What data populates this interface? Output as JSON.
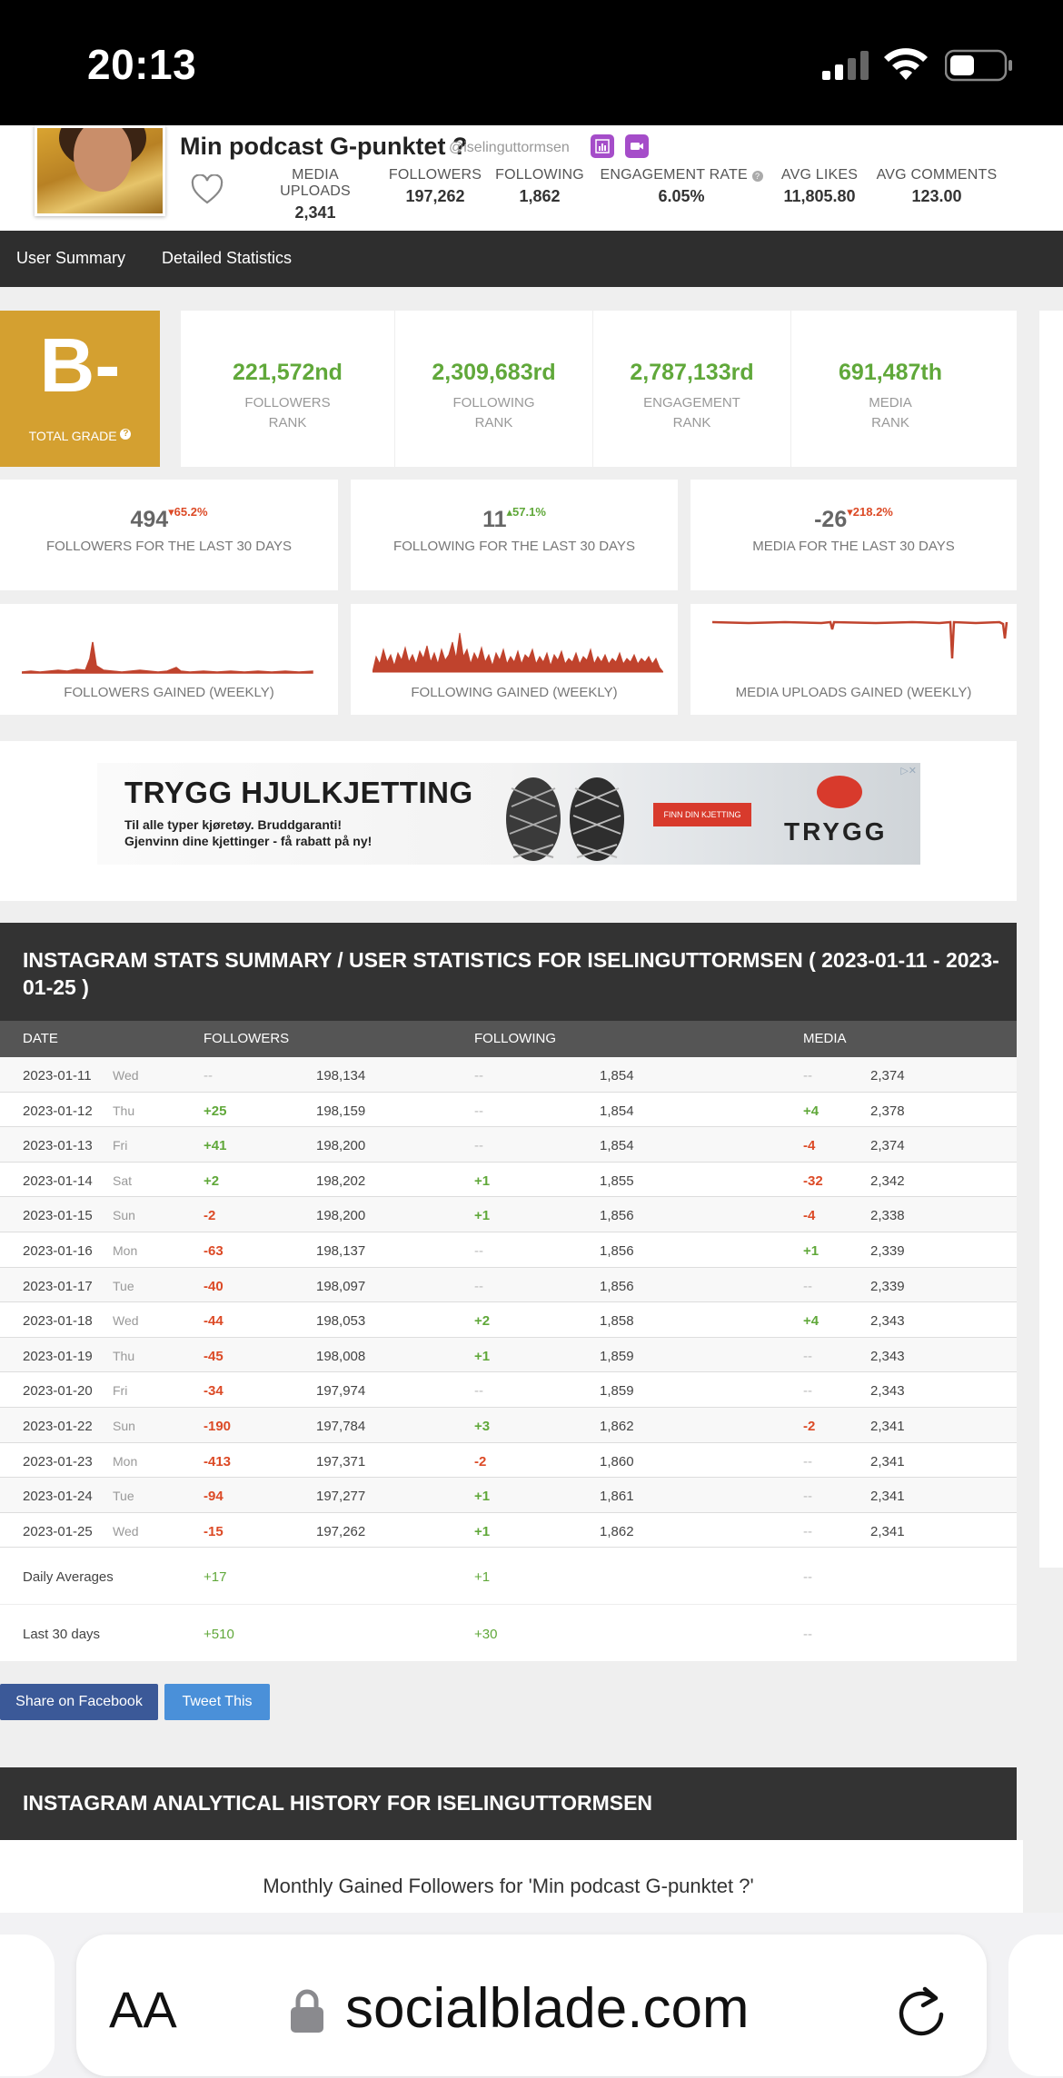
{
  "status_bar": {
    "time": "20:13"
  },
  "profile": {
    "name": "Min podcast G-punktet ?",
    "handle": "@iselinguttormsen",
    "stats": [
      {
        "label": "MEDIA UPLOADS",
        "value": "2,341"
      },
      {
        "label": "FOLLOWERS",
        "value": "197,262"
      },
      {
        "label": "FOLLOWING",
        "value": "1,862"
      },
      {
        "label": "ENGAGEMENT RATE",
        "value": "6.05%"
      },
      {
        "label": "AVG LIKES",
        "value": "11,805.80"
      },
      {
        "label": "AVG COMMENTS",
        "value": "123.00"
      }
    ]
  },
  "nav": {
    "items": [
      "User Summary",
      "Detailed Statistics"
    ]
  },
  "grade": {
    "letter": "B-",
    "label": "TOTAL GRADE",
    "help": "?"
  },
  "ranks": [
    {
      "value": "221,572nd",
      "label1": "FOLLOWERS",
      "label2": "RANK"
    },
    {
      "value": "2,309,683rd",
      "label1": "FOLLOWING",
      "label2": "RANK"
    },
    {
      "value": "2,787,133rd",
      "label1": "ENGAGEMENT",
      "label2": "RANK"
    },
    {
      "value": "691,487th",
      "label1": "MEDIA",
      "label2": "RANK"
    }
  ],
  "last30": [
    {
      "value": "494",
      "change": "▾65.2%",
      "label": "FOLLOWERS FOR THE LAST 30 DAYS"
    },
    {
      "value": "11",
      "change": "▴57.1%",
      "label": "FOLLOWING FOR THE LAST 30 DAYS"
    },
    {
      "value": "-26",
      "change": "▾218.2%",
      "label": "MEDIA FOR THE LAST 30 DAYS"
    }
  ],
  "sparklines": [
    {
      "label": "FOLLOWERS GAINED (WEEKLY)"
    },
    {
      "label": "FOLLOWING GAINED (WEEKLY)"
    },
    {
      "label": "MEDIA UPLOADS GAINED (WEEKLY)"
    }
  ],
  "ad": {
    "headline": "TRYGG HJULKJETTING",
    "line1": "Til alle typer kjøretøy. Bruddgaranti!",
    "line2": "Gjenvinn dine kjettinger - få rabatt på ny!",
    "cta": "FINN DIN KJETTING",
    "brand": "TRYGG",
    "close": "▷✕"
  },
  "summary": {
    "title": "INSTAGRAM STATS SUMMARY / USER STATISTICS FOR ISELINGUTTORMSEN ( 2023-01-11 - 2023-01-25 )",
    "columns": [
      "DATE",
      "FOLLOWERS",
      "FOLLOWING",
      "MEDIA"
    ],
    "rows": [
      {
        "date": "2023-01-11",
        "day": "Wed",
        "fch": "--",
        "fval": "198,134",
        "gch": "--",
        "gval": "1,854",
        "mch": "--",
        "mval": "2,374"
      },
      {
        "date": "2023-01-12",
        "day": "Thu",
        "fch": "+25",
        "fval": "198,159",
        "gch": "--",
        "gval": "1,854",
        "mch": "+4",
        "mval": "2,378"
      },
      {
        "date": "2023-01-13",
        "day": "Fri",
        "fch": "+41",
        "fval": "198,200",
        "gch": "--",
        "gval": "1,854",
        "mch": "-4",
        "mval": "2,374"
      },
      {
        "date": "2023-01-14",
        "day": "Sat",
        "fch": "+2",
        "fval": "198,202",
        "gch": "+1",
        "gval": "1,855",
        "mch": "-32",
        "mval": "2,342"
      },
      {
        "date": "2023-01-15",
        "day": "Sun",
        "fch": "-2",
        "fval": "198,200",
        "gch": "+1",
        "gval": "1,856",
        "mch": "-4",
        "mval": "2,338"
      },
      {
        "date": "2023-01-16",
        "day": "Mon",
        "fch": "-63",
        "fval": "198,137",
        "gch": "--",
        "gval": "1,856",
        "mch": "+1",
        "mval": "2,339"
      },
      {
        "date": "2023-01-17",
        "day": "Tue",
        "fch": "-40",
        "fval": "198,097",
        "gch": "--",
        "gval": "1,856",
        "mch": "--",
        "mval": "2,339"
      },
      {
        "date": "2023-01-18",
        "day": "Wed",
        "fch": "-44",
        "fval": "198,053",
        "gch": "+2",
        "gval": "1,858",
        "mch": "+4",
        "mval": "2,343"
      },
      {
        "date": "2023-01-19",
        "day": "Thu",
        "fch": "-45",
        "fval": "198,008",
        "gch": "+1",
        "gval": "1,859",
        "mch": "--",
        "mval": "2,343"
      },
      {
        "date": "2023-01-20",
        "day": "Fri",
        "fch": "-34",
        "fval": "197,974",
        "gch": "--",
        "gval": "1,859",
        "mch": "--",
        "mval": "2,343"
      },
      {
        "date": "2023-01-22",
        "day": "Sun",
        "fch": "-190",
        "fval": "197,784",
        "gch": "+3",
        "gval": "1,862",
        "mch": "-2",
        "mval": "2,341"
      },
      {
        "date": "2023-01-23",
        "day": "Mon",
        "fch": "-413",
        "fval": "197,371",
        "gch": "-2",
        "gval": "1,860",
        "mch": "--",
        "mval": "2,341"
      },
      {
        "date": "2023-01-24",
        "day": "Tue",
        "fch": "-94",
        "fval": "197,277",
        "gch": "+1",
        "gval": "1,861",
        "mch": "--",
        "mval": "2,341"
      },
      {
        "date": "2023-01-25",
        "day": "Wed",
        "fch": "-15",
        "fval": "197,262",
        "gch": "+1",
        "gval": "1,862",
        "mch": "--",
        "mval": "2,341"
      }
    ],
    "daily_avg": {
      "label": "Daily Averages",
      "followers": "+17",
      "following": "+1",
      "media": "--"
    },
    "last30": {
      "label": "Last 30 days",
      "followers": "+510",
      "following": "+30",
      "media": "--"
    }
  },
  "share": {
    "facebook": "Share on Facebook",
    "tweet": "Tweet This"
  },
  "history": {
    "title": "INSTAGRAM ANALYTICAL HISTORY FOR ISELINGUTTORMSEN",
    "chart_title": "Monthly Gained Followers for 'Min podcast G-punktet ?'"
  },
  "browser": {
    "text_size": "AA",
    "url": "socialblade.com"
  },
  "colors": {
    "positive": "#60a83a",
    "negative": "#dc4a26",
    "grade": "#d4a030",
    "header": "#333333",
    "sparkline": "#c0432d"
  }
}
